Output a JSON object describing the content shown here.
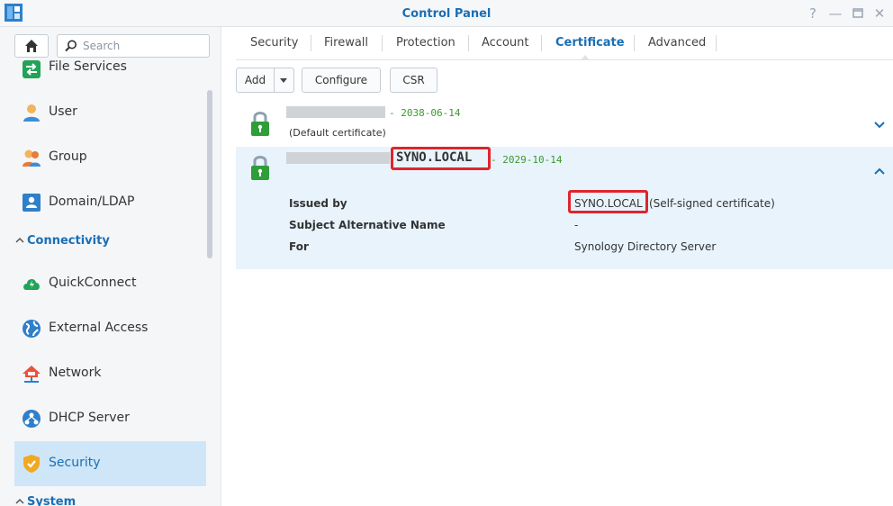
{
  "window": {
    "title": "Control Panel",
    "controls": [
      "help-icon",
      "minimize-icon",
      "maximize-icon",
      "close-icon"
    ]
  },
  "sidebar": {
    "search_placeholder": "Search",
    "items": [
      {
        "label": "File Services",
        "icon": "file-services-icon"
      },
      {
        "label": "User",
        "icon": "user-icon"
      },
      {
        "label": "Group",
        "icon": "group-icon"
      },
      {
        "label": "Domain/LDAP",
        "icon": "domain-icon"
      },
      {
        "section": "Connectivity"
      },
      {
        "label": "QuickConnect",
        "icon": "quickconnect-icon"
      },
      {
        "label": "External Access",
        "icon": "external-access-icon"
      },
      {
        "label": "Network",
        "icon": "network-icon"
      },
      {
        "label": "DHCP Server",
        "icon": "dhcp-icon"
      },
      {
        "label": "Security",
        "icon": "security-shield-icon",
        "active": true
      },
      {
        "section": "System"
      }
    ]
  },
  "tabs": [
    "Security",
    "Firewall",
    "Protection",
    "Account",
    "Certificate",
    "Advanced"
  ],
  "active_tab": "Certificate",
  "toolbar": {
    "add": "Add",
    "configure": "Configure",
    "csr": "CSR"
  },
  "certificates": [
    {
      "date": "- 2038-06-14",
      "note": "(Default certificate)",
      "expanded": false
    },
    {
      "name": "SYNO.LOCAL",
      "date": "- 2029-10-14",
      "expanded": true,
      "details": {
        "issued_by_label": "Issued by",
        "issued_by_value": "SYNO.LOCAL",
        "issued_by_suffix": "(Self-signed certificate)",
        "san_label": "Subject Alternative Name",
        "san_value": "-",
        "for_label": "For",
        "for_value": "Synology Directory Server"
      }
    }
  ],
  "colors": {
    "accent": "#1a6fb5",
    "active_bg": "#cfe6f8",
    "expanded_bg": "#e8f3fc",
    "date_green": "#3a9a2a",
    "highlight_red": "#e0242c",
    "lock_green": "#2e9e3a"
  }
}
